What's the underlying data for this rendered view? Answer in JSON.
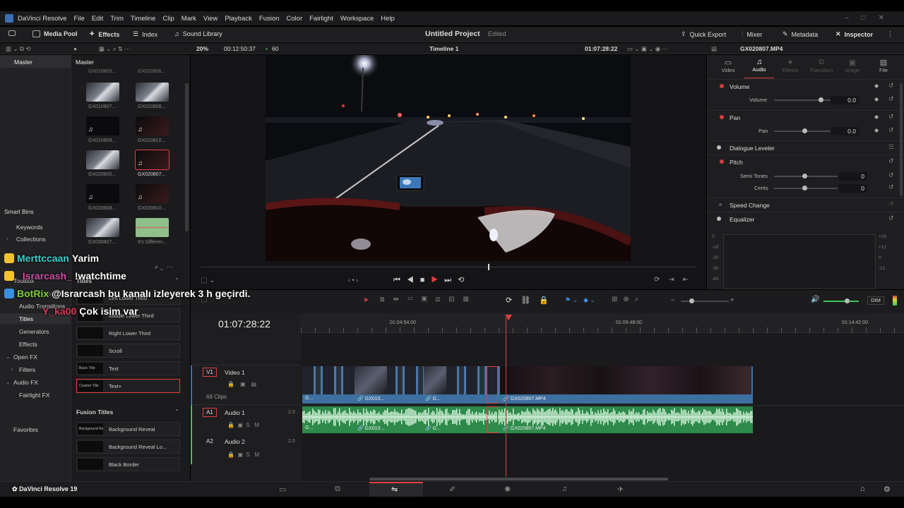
{
  "app": {
    "name": "DaVinci Resolve",
    "menu": [
      "File",
      "Edit",
      "Trim",
      "Timeline",
      "Clip",
      "Mark",
      "View",
      "Playback",
      "Fusion",
      "Color",
      "Fairlight",
      "Workspace",
      "Help"
    ],
    "footer_name": "DaVinci Resolve 19"
  },
  "toolbar": {
    "media_pool": "Media Pool",
    "effects": "Effects",
    "index": "Index",
    "sound_library": "Sound Library",
    "project_title": "Untitled Project",
    "edited": "Edited",
    "quick_export": "Quick Export",
    "mixer": "Mixer",
    "metadata": "Metadata",
    "inspector": "Inspector"
  },
  "subbar": {
    "zoom": "20%",
    "timecode_in": "00:12:50:37",
    "fps": "60",
    "timeline_name": "Timeline 1",
    "timecode_out": "01:07:28:22",
    "clip_name": "GX020807.MP4"
  },
  "left_panel": {
    "master": "Master",
    "smart_bins": "Smart Bins",
    "keywords": "Keywords",
    "collections": "Collections",
    "toolbox": "Toolbox",
    "video_transitions": "Video Transitions",
    "audio_transitions": "Audio Transitions",
    "titles": "Titles",
    "generators": "Generators",
    "effects": "Effects",
    "open_fx": "Open FX",
    "filters": "Filters",
    "audio_fx": "Audio FX",
    "fairlight_fx": "Fairlight FX",
    "favorites": "Favorites"
  },
  "media_pool": {
    "header": "Master",
    "top_labels": [
      "GX010805...",
      "GX010806..."
    ],
    "clips": [
      {
        "label": "GX010807...",
        "kind": "video"
      },
      {
        "label": "GX010808...",
        "kind": "video"
      },
      {
        "label": "GX010809...",
        "kind": "audio"
      },
      {
        "label": "GX010810...",
        "kind": "audio"
      },
      {
        "label": "GX020805...",
        "kind": "video"
      },
      {
        "label": "GX020807...",
        "kind": "audio-selected"
      },
      {
        "label": "GX020808...",
        "kind": "audio"
      },
      {
        "label": "GX020810...",
        "kind": "audio"
      },
      {
        "label": "GX030807...",
        "kind": "video"
      },
      {
        "label": "It's Differen...",
        "kind": "green"
      }
    ]
  },
  "titles_panel": {
    "header": "Titles",
    "items": [
      {
        "label": "Left Lower Third",
        "thumb": ""
      },
      {
        "label": "Middle Lower Third",
        "thumb": ""
      },
      {
        "label": "Right Lower Third",
        "thumb": ""
      },
      {
        "label": "Scroll",
        "thumb": ""
      },
      {
        "label": "Text",
        "thumb": "Basic Title"
      },
      {
        "label": "Text+",
        "thumb": "Custom Title"
      }
    ],
    "fusion_header": "Fusion Titles",
    "fusion_items": [
      {
        "label": "Background Reveal",
        "thumb": "Background Reveal"
      },
      {
        "label": "Background Reveal Lo...",
        "thumb": ""
      },
      {
        "label": "Black Border",
        "thumb": ""
      }
    ]
  },
  "inspector": {
    "tabs": [
      "Video",
      "Audio",
      "Effects",
      "Transition",
      "Image",
      "File"
    ],
    "volume_section": "Volume",
    "volume_label": "Volume",
    "volume_value": "0.0",
    "pan_section": "Pan",
    "pan_label": "Pan",
    "pan_value": "0.0",
    "dialogue_leveler": "Dialogue Leveler",
    "pitch_section": "Pitch",
    "semi_tones_label": "Semi Tones",
    "semi_tones_value": "0",
    "cents_label": "Cents",
    "cents_value": "0",
    "speed_change": "Speed Change",
    "equalizer": "Equalizer",
    "eq_labels_left": [
      "0",
      "-10",
      "-20",
      "-30",
      "-40"
    ],
    "eq_labels_right": [
      "+24",
      "+12",
      "0",
      "-12"
    ]
  },
  "timeline": {
    "current_timecode": "01:07:28:22",
    "ruler_marks": [
      "01:04:54:00",
      "01:09:48:00",
      "01:14:42:00"
    ],
    "v1": {
      "id": "V1",
      "name": "Video 1",
      "clips": "69 Clips"
    },
    "a1": {
      "id": "A1",
      "name": "Audio 1",
      "level": "2.0"
    },
    "a2": {
      "id": "A2",
      "name": "Audio 2",
      "level": "2.0"
    },
    "clip_labels": {
      "g_short": "G...",
      "gx010": "GX010...",
      "gx020807": "GX020807.MP4"
    },
    "dim": "DIM",
    "sm_labels": {
      "s": "S",
      "m": "M"
    }
  },
  "chat_overlay": [
    {
      "user": "Merttccaan",
      "message": "Yarim",
      "user_color": "#3fd1d1",
      "badge_color": "#f2c230"
    },
    {
      "user": "_Israrcash_",
      "message": "!watchtime",
      "user_color": "#d24fa8",
      "badge_color": "#f2c230"
    },
    {
      "user": "BotRix",
      "message": "@Israrcash bu kanalı izleyerek 3 h geçirdi.",
      "user_color": "#7fd13a",
      "badge_color": "#3b8fe0"
    },
    {
      "user": "Y_ka00",
      "message": "Çok isim var",
      "user_color": "#e03a5a",
      "badge_color": ""
    }
  ]
}
